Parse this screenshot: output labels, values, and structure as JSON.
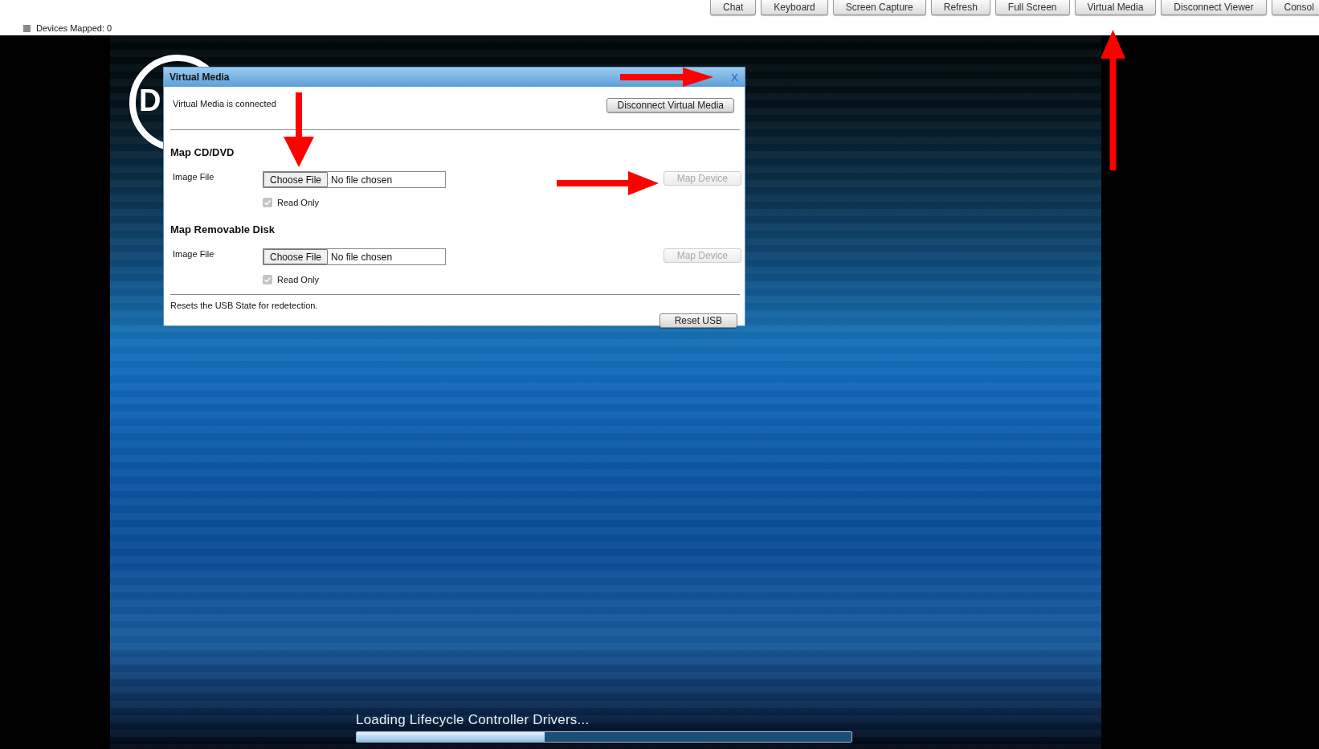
{
  "toolbar": {
    "buttons": [
      "Chat",
      "Keyboard",
      "Screen Capture",
      "Refresh",
      "Full Screen",
      "Virtual Media",
      "Disconnect Viewer",
      "Consol"
    ],
    "status": "Devices Mapped: 0"
  },
  "console_screen": {
    "logo_text": "D",
    "loading_text": "Loading Lifecycle Controller Drivers...",
    "progress": {
      "level": 0.38
    }
  },
  "dialog": {
    "title": "Virtual Media",
    "close": "X",
    "status_text": "Virtual Media is connected",
    "disconnect_button": "Disconnect Virtual Media",
    "sections": [
      {
        "heading": "Map CD/DVD",
        "field_label": "Image File",
        "choose_button": "Choose File",
        "file_status": "No file chosen",
        "read_only": {
          "label": "Read Only",
          "checked": true,
          "disabled": true
        },
        "map_button": {
          "label": "Map Device",
          "disabled": true
        }
      },
      {
        "heading": "Map Removable Disk",
        "field_label": "Image File",
        "choose_button": "Choose File",
        "file_status": "No file chosen",
        "read_only": {
          "label": "Read Only",
          "checked": true,
          "disabled": true
        },
        "map_button": {
          "label": "Map Device",
          "disabled": true
        }
      }
    ],
    "reset_text": "Resets the USB State for redetection.",
    "reset_button": "Reset USB"
  },
  "annotations": [
    {
      "kind": "rightarrow"
    },
    {
      "kind": "downarrow"
    },
    {
      "kind": "rightarrow"
    },
    {
      "kind": "uparrow"
    }
  ]
}
